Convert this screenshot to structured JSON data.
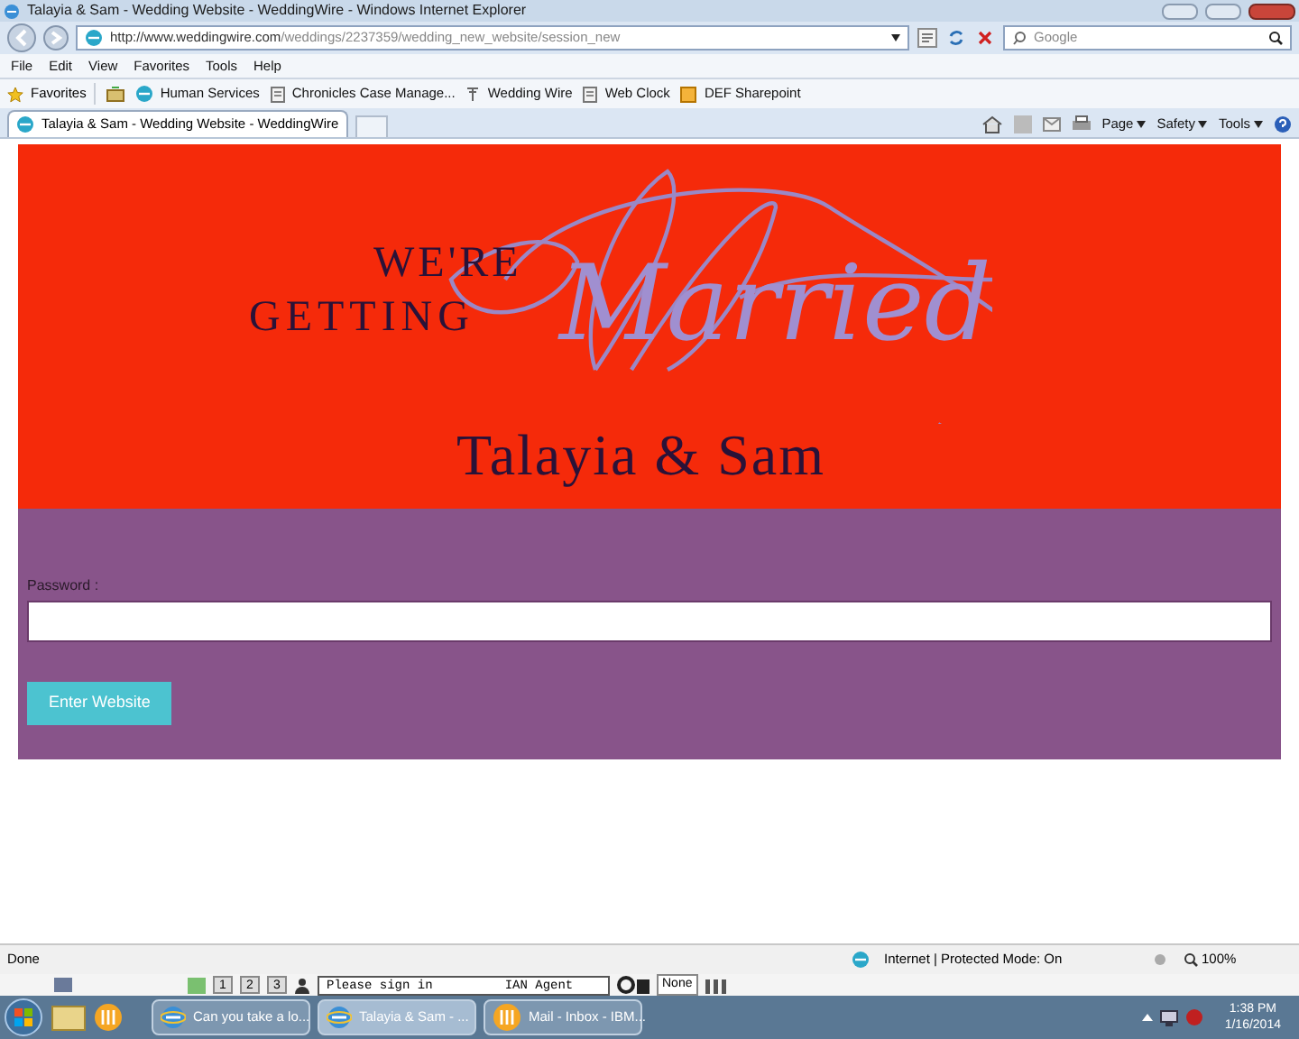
{
  "window": {
    "title": "Talayia & Sam - Wedding Website - WeddingWire - Windows Internet Explorer"
  },
  "address_bar": {
    "url_host": "http://www.weddingwire.com",
    "url_path": "/weddings/2237359/wedding_new_website/session_new"
  },
  "search": {
    "placeholder": "Google"
  },
  "menu": [
    "File",
    "Edit",
    "View",
    "Favorites",
    "Tools",
    "Help"
  ],
  "favorites_bar": {
    "label": "Favorites",
    "items": [
      {
        "label": "Human Services",
        "kind": "globe"
      },
      {
        "label": "Chronicles Case Manage...",
        "kind": "page"
      },
      {
        "label": "Wedding Wire",
        "kind": "pin"
      },
      {
        "label": "Web Clock",
        "kind": "page"
      },
      {
        "label": "DEF Sharepoint",
        "kind": "folder"
      }
    ]
  },
  "tabs": [
    {
      "label": "Talayia & Sam - Wedding Website - WeddingWire",
      "selected": true
    }
  ],
  "command_bar": [
    "Page",
    "Safety",
    "Tools"
  ],
  "banner": {
    "line_1": "WE'RE",
    "line_2": "GETTING",
    "script": "Married",
    "names": "Talayia & Sam"
  },
  "form": {
    "password_label": "Password :",
    "button": "Enter Website"
  },
  "status_bar": {
    "left": "Done",
    "zone": "Internet | Protected Mode: On",
    "zoom": "100%"
  },
  "app_strip": {
    "keys": [
      "1",
      "2",
      "3"
    ],
    "message": "Please sign in",
    "agent": "IAN Agent",
    "state": "None"
  },
  "taskbar": {
    "buttons": [
      {
        "label": "Can you take a lo...",
        "kind": "ie",
        "selected": false
      },
      {
        "label": "Talayia & Sam - ...",
        "kind": "ie",
        "selected": true
      },
      {
        "label": "Mail - Inbox - IBM...",
        "kind": "notes",
        "selected": false
      }
    ],
    "time": "1:38 PM",
    "date": "1/16/2014"
  }
}
